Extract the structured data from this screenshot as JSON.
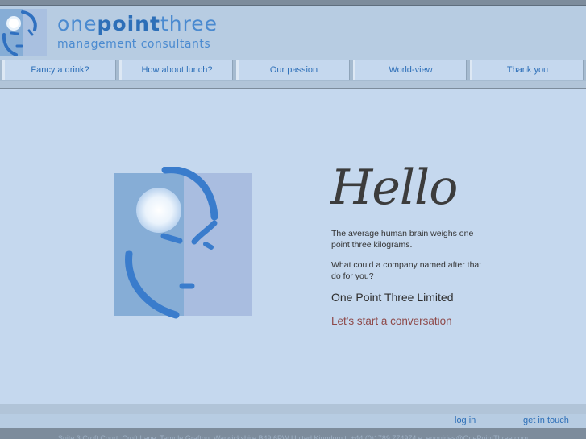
{
  "header": {
    "logo_text_light_1": "one",
    "logo_text_bold": "point",
    "logo_text_light_2": "three",
    "tagline": "management consultants"
  },
  "nav": {
    "items": [
      {
        "label": "Fancy a drink?"
      },
      {
        "label": "How about lunch?"
      },
      {
        "label": "Our passion"
      },
      {
        "label": "World-view"
      },
      {
        "label": "Thank you"
      }
    ]
  },
  "main": {
    "greeting": "Hello",
    "paragraph_1": "The average human brain weighs one point three kilograms.",
    "paragraph_2": "What could a company named after that do for you?",
    "company_name": "One Point Three Limited",
    "cta": "Let's start a conversation"
  },
  "footer": {
    "login": "log in",
    "contact": "get in touch",
    "address": "Suite 3 Croft Court, Croft Lane, Temple Grafton, Warwickshire B49 6PW United Kingdom  t: +44 (0)1789 774974  e: enquiries@OnePointThree.com"
  },
  "colors": {
    "brand_blue": "#2d6fb8",
    "background": "#c5d8ee",
    "cta": "#8e4a4a"
  }
}
